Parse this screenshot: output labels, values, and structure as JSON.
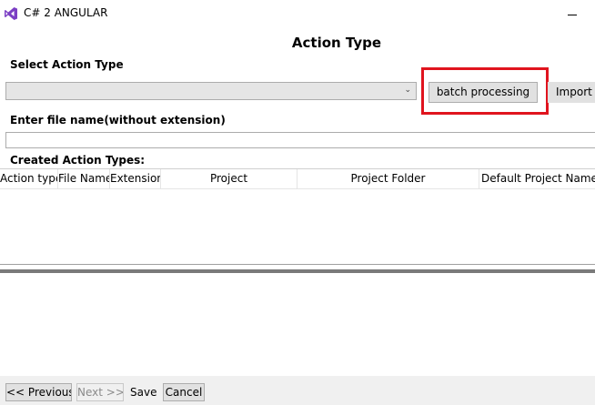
{
  "window": {
    "title": "C# 2 ANGULAR"
  },
  "page": {
    "heading": "Action Type",
    "select_action_label": "Select Action Type",
    "select_value": "",
    "batch_button_label": "batch processing",
    "import_button_label": "Import c",
    "file_name_label": "Enter file name(without extension)",
    "file_name_value": "",
    "created_label": "Created Action Types:"
  },
  "grid": {
    "columns": [
      "Action type",
      "File Name",
      "Extension",
      "Project",
      "Project Folder",
      "Default Project NameSp"
    ],
    "rows": []
  },
  "footer": {
    "previous_label": "<< Previous",
    "next_label": "Next >>",
    "save_label": "Save",
    "cancel_label": "Cancel"
  },
  "colors": {
    "highlight": "#e0141e",
    "app_icon": "#7b3fc4"
  }
}
